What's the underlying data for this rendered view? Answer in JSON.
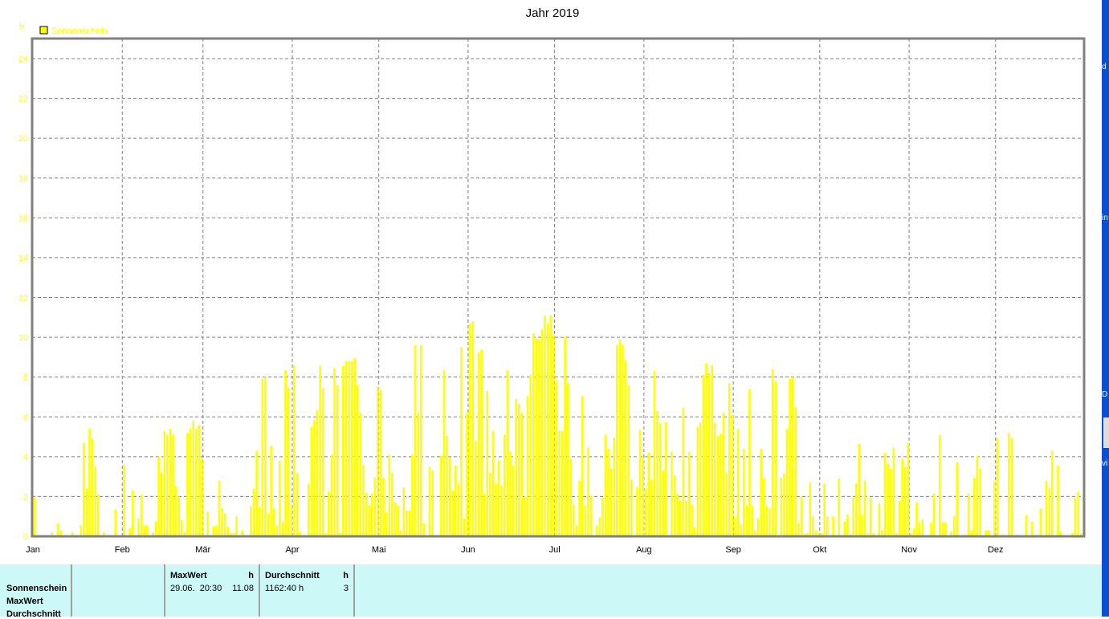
{
  "chart_data": {
    "type": "bar",
    "title": "Jahr 2019",
    "ylabel": "h",
    "xlabel": "",
    "ylim": [
      0,
      25
    ],
    "yticks": [
      0,
      2,
      4,
      6,
      8,
      10,
      12,
      14,
      16,
      18,
      20,
      22,
      24
    ],
    "grid": true,
    "legend": {
      "placement": "top-left",
      "entries": [
        {
          "name": "Sonnenschein",
          "color": "#ffff00"
        }
      ]
    },
    "months": [
      "Jan",
      "Feb",
      "Mär",
      "Apr",
      "Mai",
      "Jun",
      "Jul",
      "Aug",
      "Sep",
      "Okt",
      "Nov",
      "Dez"
    ],
    "month_start_day": [
      0,
      31,
      59,
      90,
      120,
      151,
      181,
      212,
      243,
      273,
      304,
      334
    ],
    "days_in_year": 365,
    "series": [
      {
        "name": "Sonnenschein",
        "color": "#ffff00",
        "values": [
          1.96,
          0,
          0,
          0,
          0,
          0,
          0.2,
          0,
          0.65,
          0.3,
          0,
          0,
          0,
          0.2,
          0,
          0,
          0.55,
          4.7,
          2.4,
          5.4,
          4.9,
          3.5,
          2.1,
          0,
          0.2,
          0,
          0,
          0,
          1.35,
          0,
          0,
          3.6,
          0,
          0.4,
          2.3,
          0,
          0.9,
          2.1,
          0.55,
          0.55,
          0,
          0.2,
          0.75,
          4.0,
          3.2,
          5.3,
          5.1,
          5.4,
          5.1,
          2.5,
          2.0,
          0.8,
          0.2,
          5.2,
          5.4,
          5.8,
          5.4,
          5.6,
          3.9,
          0,
          1.25,
          0,
          0.5,
          0.55,
          2.8,
          1.4,
          1.15,
          0.5,
          0.15,
          0.15,
          1.0,
          0,
          0.3,
          0,
          0,
          1.5,
          2.4,
          4.3,
          1.5,
          7.9,
          8.0,
          1.15,
          4.55,
          1.4,
          0.55,
          3.8,
          0.7,
          8.35,
          7.45,
          1.55,
          8.6,
          3.2,
          0.25,
          0,
          0,
          2.65,
          5.5,
          5.85,
          6.35,
          8.55,
          7.45,
          0.15,
          2.25,
          4.1,
          8.45,
          7.6,
          0.15,
          8.55,
          8.8,
          8.8,
          8.8,
          8.95,
          7.6,
          6.2,
          3.6,
          2.2,
          1.55,
          2.15,
          2.95,
          7.5,
          7.35,
          2.95,
          1.2,
          4.1,
          3.2,
          1.7,
          1.55,
          0.3,
          2.45,
          1.3,
          1.3,
          4.1,
          9.6,
          6.2,
          9.6,
          0.65,
          0,
          3.5,
          3.3,
          0,
          0,
          4.05,
          8.35,
          5.05,
          3.95,
          2.3,
          3.55,
          2.65,
          9.5,
          0.9,
          6.2,
          10.7,
          10.8,
          4.8,
          9.25,
          9.4,
          2.15,
          7.3,
          3.2,
          5.3,
          2.65,
          3.8,
          2.55,
          5.1,
          8.35,
          4.25,
          3.55,
          6.9,
          6.65,
          6.2,
          1.95,
          7.05,
          8.1,
          10.2,
          9.95,
          9.9,
          10.4,
          11.08,
          10.7,
          11.1,
          10.1,
          7.85,
          5.3,
          5.3,
          10.0,
          7.7,
          3.9,
          1.6,
          0.55,
          2.8,
          7.05,
          1.55,
          4.45,
          2.05,
          0,
          0.55,
          0.95,
          1.95,
          5.1,
          4.4,
          3.4,
          4.95,
          9.6,
          9.9,
          9.6,
          8.85,
          7.6,
          2.85,
          0.05,
          2.45,
          5.35,
          3.95,
          2.4,
          4.2,
          2.85,
          8.3,
          6.3,
          5.7,
          3.3,
          5.75,
          0,
          4.25,
          3.05,
          2.15,
          1.8,
          6.45,
          1.8,
          4.25,
          1.6,
          0.45,
          5.5,
          5.7,
          8.1,
          8.7,
          8.2,
          8.6,
          5.7,
          5.05,
          5.15,
          6.2,
          3.2,
          7.7,
          6.1,
          0.95,
          5.4,
          0.6,
          4.4,
          1.55,
          7.4,
          1.55,
          0.3,
          0.9,
          4.4,
          2.95,
          1.55,
          1.4,
          8.4,
          7.8,
          0,
          2.95,
          3.15,
          5.4,
          7.9,
          8.0,
          6.5,
          0.65,
          2.0,
          0.1,
          0.15,
          2.7,
          1.0,
          0.3,
          0.15,
          0.15,
          2.65,
          1.0,
          0,
          1.0,
          0,
          2.9,
          0,
          0.75,
          1.1,
          0.1,
          1.95,
          2.65,
          4.65,
          1.1,
          2.8,
          0.15,
          1.95,
          0.15,
          0,
          1.65,
          0.3,
          4.2,
          3.65,
          3.4,
          4.45,
          0.15,
          1.8,
          3.9,
          3.5,
          4.7,
          0.15,
          0.4,
          1.7,
          0.7,
          0.85,
          0,
          0,
          0.7,
          2.15,
          0,
          5.1,
          0.7,
          0.7,
          0,
          0.25,
          1.0,
          3.7,
          0,
          0,
          0.08,
          2.15,
          0.3,
          2.95,
          4.05,
          3.4,
          0,
          0.3,
          0.3,
          0,
          2.8,
          4.95,
          0,
          0.08,
          0,
          5.2,
          4.95,
          0,
          0.08,
          0,
          0,
          1.07,
          0,
          0.75,
          0,
          0.08,
          1.4,
          0,
          2.8,
          2.4,
          4.3,
          0,
          3.55,
          0.25,
          0,
          0,
          0,
          0.15,
          1.95,
          2.25,
          0.15,
          2.55
        ]
      }
    ]
  },
  "colors": {
    "bar": "#ffff00",
    "frame": "#808080",
    "grid": "#808080",
    "table_bg": "#ccf8f8",
    "desktop": "#0a4fd0"
  },
  "table": {
    "row_labels": [
      "Sonnenschein",
      "MaxWert",
      "Durchschnitt"
    ],
    "maxwert": {
      "header": "MaxWert",
      "unit": "h",
      "datetime": "29.06.  20:30",
      "value": "11.08"
    },
    "durchschnitt": {
      "header": "Durchschnitt",
      "unit": "h",
      "total": "1162:40 h",
      "value": "3"
    }
  },
  "desktop_edge": {
    "letters": [
      "d",
      "in",
      "D",
      "vi"
    ]
  }
}
